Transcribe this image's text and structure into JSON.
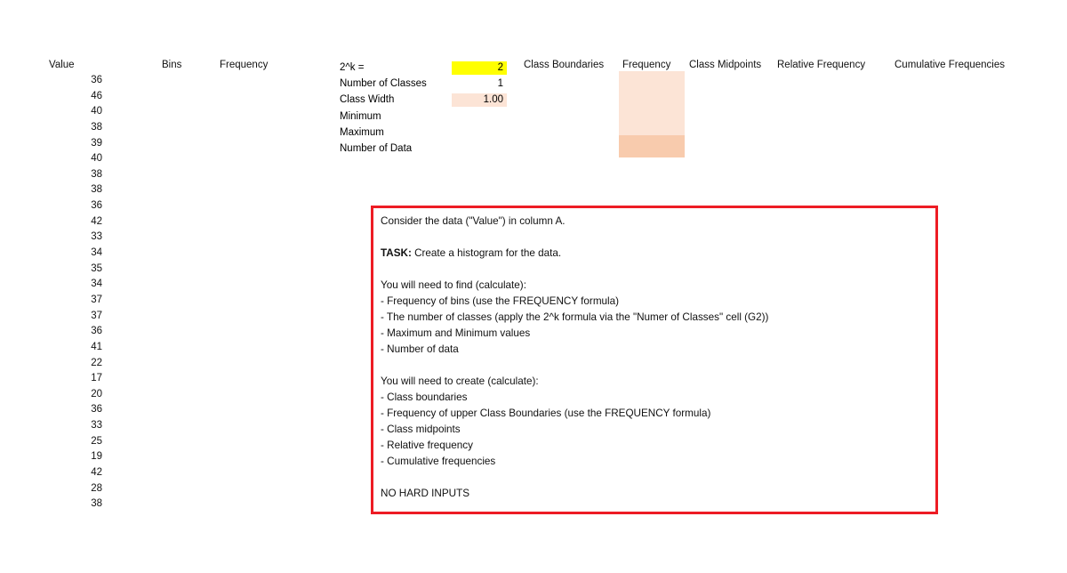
{
  "sheet": {
    "background": "#ffffff",
    "columns": {
      "value_header": "Value",
      "bins_header": "Bins",
      "frequency_header": "Frequency"
    },
    "values": [
      36,
      46,
      40,
      38,
      39,
      40,
      38,
      38,
      36,
      42,
      33,
      34,
      35,
      34,
      37,
      37,
      36,
      41,
      22,
      17,
      20,
      36,
      33,
      25,
      19,
      42,
      28,
      38
    ],
    "bins": [],
    "frequency": []
  },
  "calculations": {
    "rows": [
      {
        "label": "2^k =",
        "value": "2",
        "fill": "#ffff00"
      },
      {
        "label": "Number of Classes",
        "value": "1",
        "fill": "none"
      },
      {
        "label": "Class Width",
        "value": "1.00",
        "fill": "#fce4d6"
      },
      {
        "label": "Minimum",
        "value": "",
        "fill": "none"
      },
      {
        "label": "Maximum",
        "value": "",
        "fill": "none"
      },
      {
        "label": "Number of Data",
        "value": "",
        "fill": "none"
      }
    ]
  },
  "table_headers": {
    "class_boundaries": "Class Boundaries",
    "frequency": "Frequency",
    "class_midpoints": "Class Midpoints",
    "relative_frequency": "Relative Frequency",
    "cumulative_frequencies": "Cumulative Frequencies"
  },
  "frequency_fill": {
    "light": "#fce4d6",
    "accent": "#f8cbad"
  },
  "instructions": {
    "border_color": "#ed1c24",
    "lines": [
      {
        "text": "Consider the data (\"Value\") in column A.",
        "bold_prefix": ""
      },
      {
        "text": "",
        "bold_prefix": ""
      },
      {
        "text": "Create a histogram for the data.",
        "bold_prefix": "TASK:"
      },
      {
        "text": "",
        "bold_prefix": ""
      },
      {
        "text": "You will need to find (calculate):",
        "bold_prefix": ""
      },
      {
        "text": "- Frequency of bins (use the FREQUENCY formula)",
        "bold_prefix": ""
      },
      {
        "text": "- The number of classes (apply the 2^k formula via the \"Numer of Classes\" cell (G2))",
        "bold_prefix": ""
      },
      {
        "text": "- Maximum and Minimum values",
        "bold_prefix": ""
      },
      {
        "text": "- Number of data",
        "bold_prefix": ""
      },
      {
        "text": "",
        "bold_prefix": ""
      },
      {
        "text": "You will need to create (calculate):",
        "bold_prefix": ""
      },
      {
        "text": "- Class boundaries",
        "bold_prefix": ""
      },
      {
        "text": "- Frequency of upper Class Boundaries (use the FREQUENCY formula)",
        "bold_prefix": ""
      },
      {
        "text": "- Class midpoints",
        "bold_prefix": ""
      },
      {
        "text": "- Relative frequency",
        "bold_prefix": ""
      },
      {
        "text": "- Cumulative frequencies",
        "bold_prefix": ""
      },
      {
        "text": "",
        "bold_prefix": ""
      },
      {
        "text": "NO HARD INPUTS",
        "bold_prefix": ""
      }
    ]
  }
}
